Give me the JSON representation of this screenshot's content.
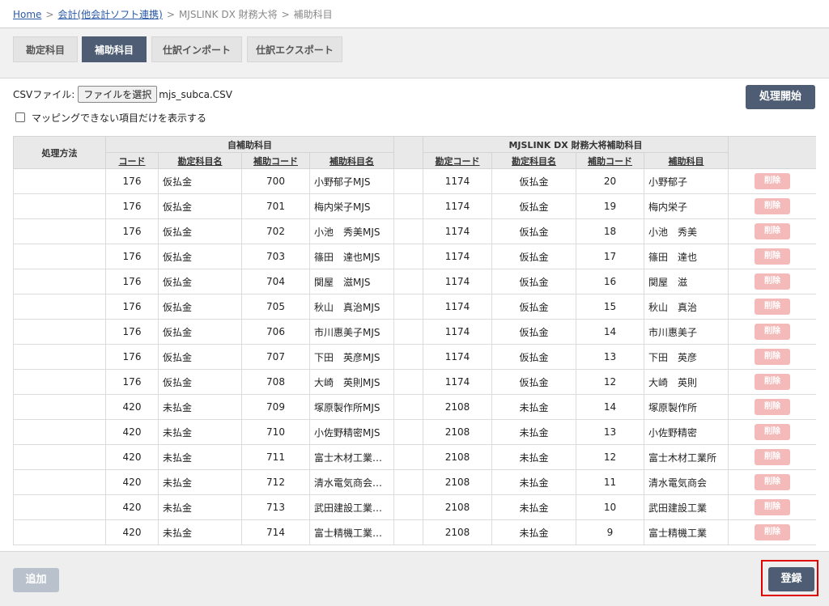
{
  "breadcrumb": {
    "home": "Home",
    "sep": ">",
    "parent": "会計(他会計ソフト連携)",
    "product": "MJSLINK DX 財務大将",
    "current": "補助科目"
  },
  "tabs": [
    {
      "label": "勘定科目",
      "active": false
    },
    {
      "label": "補助科目",
      "active": true
    },
    {
      "label": "仕訳インポート",
      "active": false
    },
    {
      "label": "仕訳エクスポート",
      "active": false
    }
  ],
  "csv": {
    "label": "CSVファイル:",
    "choose_label": "ファイルを選択",
    "filename": "mjs_subca.CSV"
  },
  "filter_checkbox": {
    "label": "マッピングできない項目だけを表示する",
    "checked": false
  },
  "process_button": "処理開始",
  "table": {
    "method_header": "処理方法",
    "own_group": "自補助科目",
    "mjs_group": "MJSLINK DX 財務大将補助科目",
    "own_cols": [
      "コード",
      "勘定科目名",
      "補助コード",
      "補助科目名"
    ],
    "mjs_cols": [
      "勘定コード",
      "勘定科目名",
      "補助コード",
      "補助科目"
    ],
    "delete_label": "削除",
    "rows": [
      {
        "code": "176",
        "acct": "仮払金",
        "sub_code": "700",
        "sub_name": "小野郁子MJS",
        "m_code": "1174",
        "m_acct": "仮払金",
        "m_sub_code": "20",
        "m_sub": "小野郁子"
      },
      {
        "code": "176",
        "acct": "仮払金",
        "sub_code": "701",
        "sub_name": "梅内栄子MJS",
        "m_code": "1174",
        "m_acct": "仮払金",
        "m_sub_code": "19",
        "m_sub": "梅内栄子"
      },
      {
        "code": "176",
        "acct": "仮払金",
        "sub_code": "702",
        "sub_name": "小池　秀美MJS",
        "m_code": "1174",
        "m_acct": "仮払金",
        "m_sub_code": "18",
        "m_sub": "小池　秀美"
      },
      {
        "code": "176",
        "acct": "仮払金",
        "sub_code": "703",
        "sub_name": "篠田　達也MJS",
        "m_code": "1174",
        "m_acct": "仮払金",
        "m_sub_code": "17",
        "m_sub": "篠田　達也"
      },
      {
        "code": "176",
        "acct": "仮払金",
        "sub_code": "704",
        "sub_name": "関屋　滋MJS",
        "m_code": "1174",
        "m_acct": "仮払金",
        "m_sub_code": "16",
        "m_sub": "関屋　滋"
      },
      {
        "code": "176",
        "acct": "仮払金",
        "sub_code": "705",
        "sub_name": "秋山　真治MJS",
        "m_code": "1174",
        "m_acct": "仮払金",
        "m_sub_code": "15",
        "m_sub": "秋山　真治"
      },
      {
        "code": "176",
        "acct": "仮払金",
        "sub_code": "706",
        "sub_name": "市川惠美子MJS",
        "m_code": "1174",
        "m_acct": "仮払金",
        "m_sub_code": "14",
        "m_sub": "市川惠美子"
      },
      {
        "code": "176",
        "acct": "仮払金",
        "sub_code": "707",
        "sub_name": "下田　英彦MJS",
        "m_code": "1174",
        "m_acct": "仮払金",
        "m_sub_code": "13",
        "m_sub": "下田　英彦"
      },
      {
        "code": "176",
        "acct": "仮払金",
        "sub_code": "708",
        "sub_name": "大崎　英則MJS",
        "m_code": "1174",
        "m_acct": "仮払金",
        "m_sub_code": "12",
        "m_sub": "大崎　英則"
      },
      {
        "code": "420",
        "acct": "未払金",
        "sub_code": "709",
        "sub_name": "塚原製作所MJS",
        "m_code": "2108",
        "m_acct": "未払金",
        "m_sub_code": "14",
        "m_sub": "塚原製作所"
      },
      {
        "code": "420",
        "acct": "未払金",
        "sub_code": "710",
        "sub_name": "小佐野精密MJS",
        "m_code": "2108",
        "m_acct": "未払金",
        "m_sub_code": "13",
        "m_sub": "小佐野精密"
      },
      {
        "code": "420",
        "acct": "未払金",
        "sub_code": "711",
        "sub_name": "富士木材工業所…",
        "m_code": "2108",
        "m_acct": "未払金",
        "m_sub_code": "12",
        "m_sub": "富士木材工業所"
      },
      {
        "code": "420",
        "acct": "未払金",
        "sub_code": "712",
        "sub_name": "清水電気商会MJS",
        "m_code": "2108",
        "m_acct": "未払金",
        "m_sub_code": "11",
        "m_sub": "清水電気商会"
      },
      {
        "code": "420",
        "acct": "未払金",
        "sub_code": "713",
        "sub_name": "武田建設工業MJS",
        "m_code": "2108",
        "m_acct": "未払金",
        "m_sub_code": "10",
        "m_sub": "武田建設工業"
      },
      {
        "code": "420",
        "acct": "未払金",
        "sub_code": "714",
        "sub_name": "富士精機工業MJS",
        "m_code": "2108",
        "m_acct": "未払金",
        "m_sub_code": "9",
        "m_sub": "富士精機工業"
      }
    ]
  },
  "footer": {
    "add_label": "追加",
    "register_label": "登録"
  },
  "colors": {
    "primary": "#4e5d73",
    "delete": "#f4b9b9",
    "highlight": "#e00000"
  }
}
